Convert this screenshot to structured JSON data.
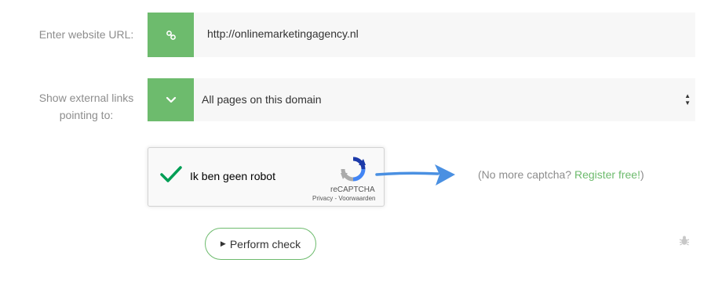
{
  "url_label": "Enter website URL:",
  "url_value": "http://onlinemarketingagency.nl",
  "links_label": "Show external links pointing to:",
  "links_selected": "All pages on this domain",
  "captcha": {
    "checkbox_label": "Ik ben geen robot",
    "brand": "reCAPTCHA",
    "privacy": "Privacy",
    "separator": " - ",
    "terms": "Voorwaarden"
  },
  "promo": {
    "prefix": "(No more captcha? ",
    "link": "Register free!",
    "suffix": ")"
  },
  "perform_label": "Perform check",
  "colors": {
    "accent": "#6dbb6d",
    "arrow": "#4a90e2"
  },
  "icons": {
    "url_addon": "link-icon",
    "links_addon": "chevron-down-icon",
    "debug": "bug-icon"
  }
}
